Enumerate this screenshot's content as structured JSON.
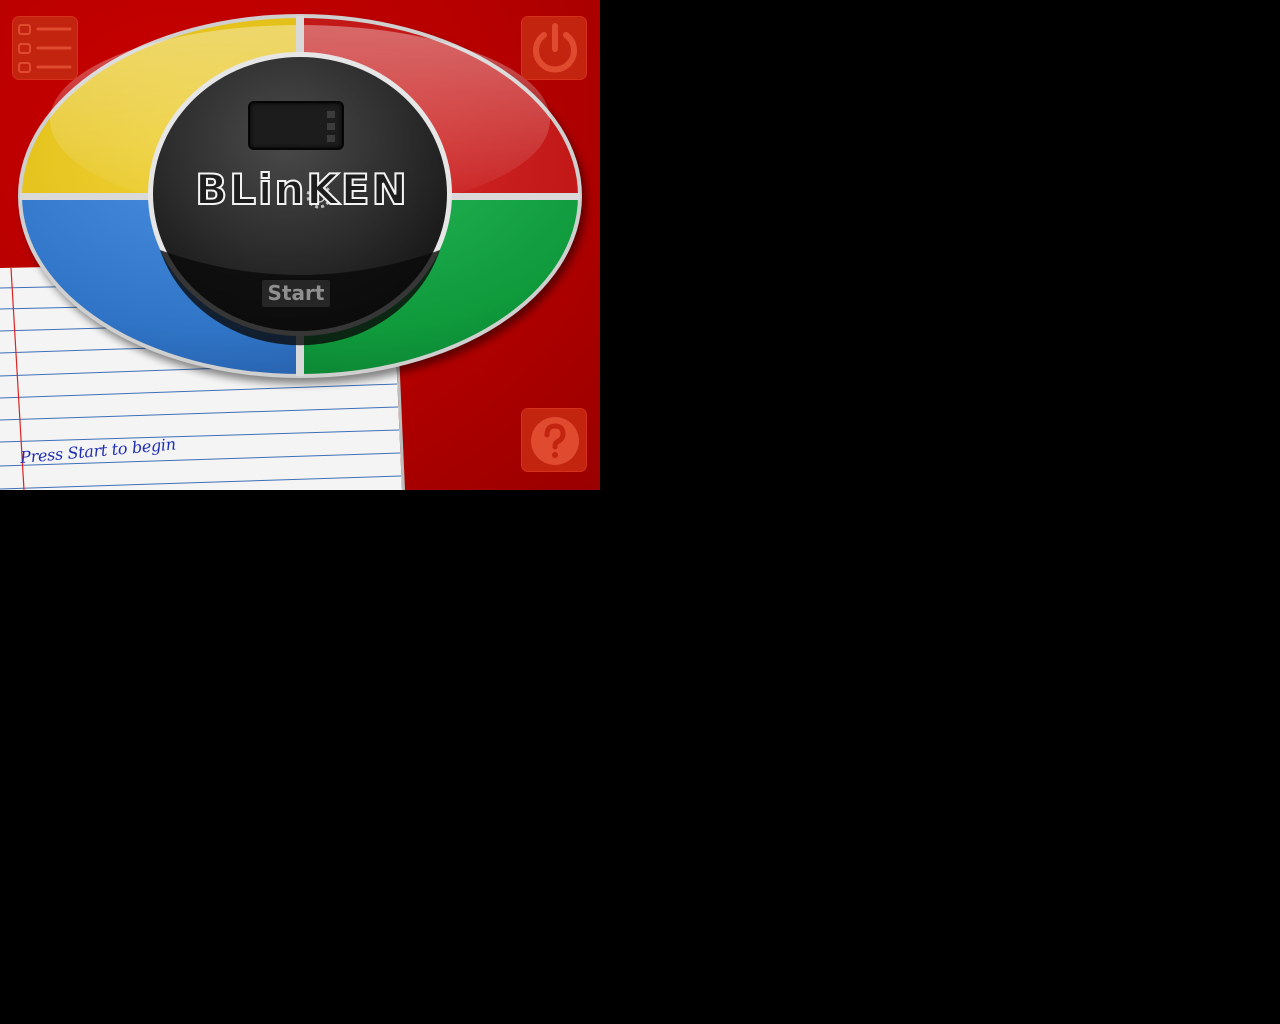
{
  "game": {
    "logo_text": "BLinKEN",
    "start_label": "Start",
    "status_text": "Press Start to begin",
    "score_value": ""
  },
  "buttons": {
    "menu_icon": "menu-list-icon",
    "power_icon": "power-icon",
    "help_icon": "question-mark-icon"
  },
  "colors": {
    "background_red": "#b50000",
    "yellow": "#e6c21a",
    "red": "#c41616",
    "blue": "#2f76c8",
    "green": "#0f9a3c",
    "center": "#2a2a2a",
    "handwriting": "#1f2fb5"
  }
}
